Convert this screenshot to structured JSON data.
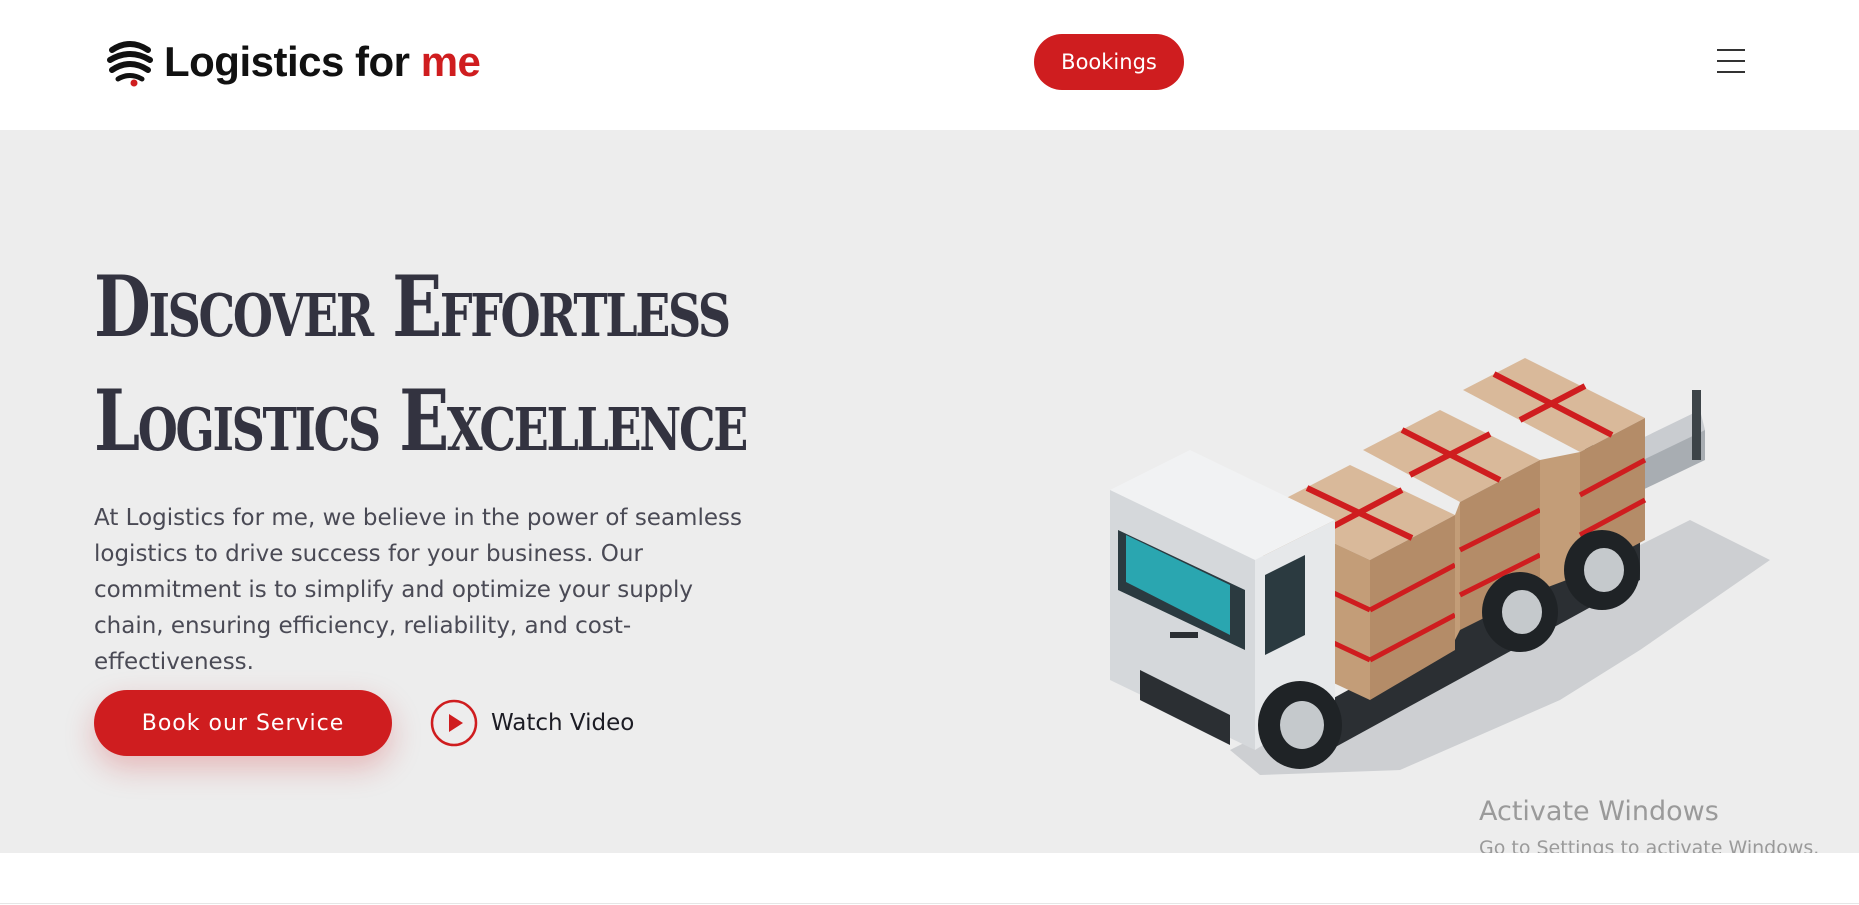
{
  "header": {
    "logo_text": "Logistics for",
    "logo_accent": "me",
    "bookings_label": "Bookings",
    "menu_icon": "hamburger-menu-icon"
  },
  "hero": {
    "title_line1": "Discover Effortless",
    "title_line2": "Logistics Excellence",
    "description": "At Logistics for me, we believe in the power of seamless logistics to drive success for your business. Our commitment is to simplify and optimize your supply chain, ensuring efficiency, reliability, and cost-effectiveness.",
    "book_button_label": "Book our Service",
    "watch_video_label": "Watch Video",
    "illustration": "cargo-truck-illustration"
  },
  "overlay": {
    "activate_title": "Activate Windows",
    "activate_subtitle": "Go to Settings to activate Windows."
  },
  "colors": {
    "brand_red": "#cf1d1f",
    "hero_background": "#ededed",
    "heading_text": "#333340",
    "body_text": "#4a4a55"
  }
}
